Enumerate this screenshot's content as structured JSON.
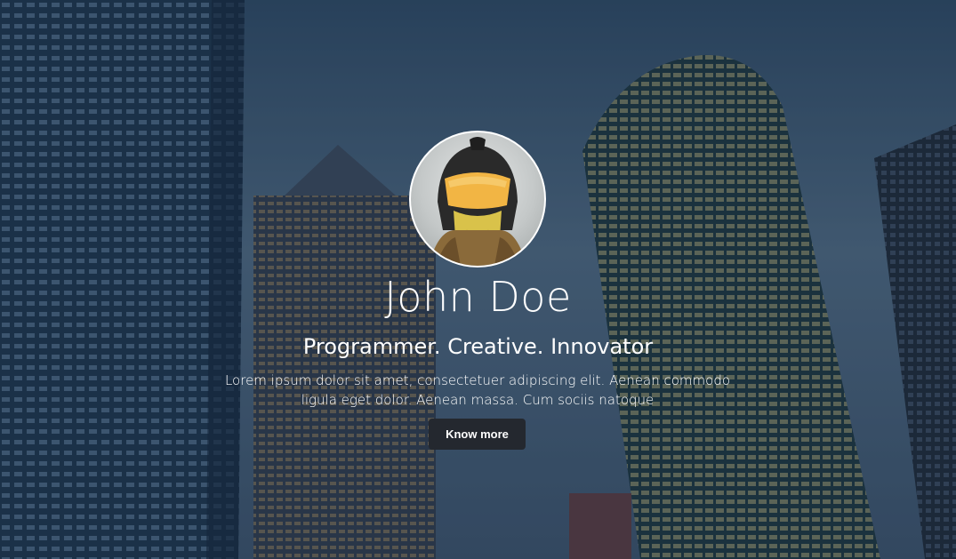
{
  "hero": {
    "name": "John Doe",
    "tagline": "Programmer. Creative. Innovator",
    "intro": "Lorem ipsum dolor sit amet, consectetuer adipiscing elit. Aenean commodo ligula eget dolor. Aenean massa. Cum sociis natoque",
    "cta_label": "Know more",
    "avatar_icon": "avatar-icon",
    "background_image": "city-skyscrapers-background"
  },
  "colors": {
    "button_bg": "#24282f",
    "text": "#ffffff",
    "sky": "#3a5877"
  }
}
